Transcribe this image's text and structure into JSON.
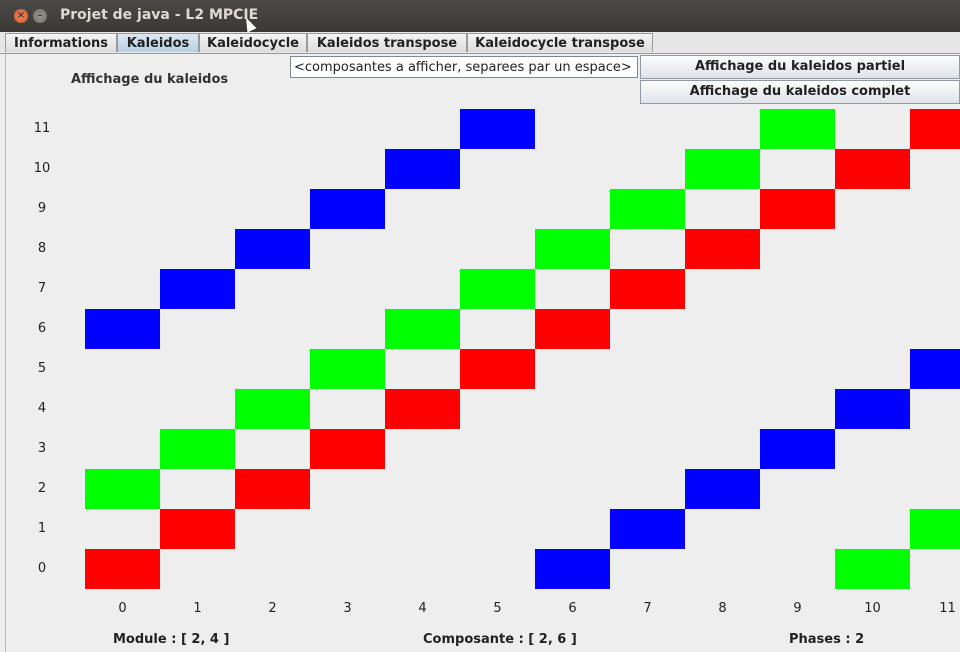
{
  "window": {
    "title": "Projet de java - L2 MPCIE"
  },
  "tabs": [
    "Informations",
    "Kaleidos",
    "Kaleidocycle",
    "Kaleidos transpose",
    "Kaleidocycle transpose"
  ],
  "heading": "Affichage du kaleidos",
  "components_input": {
    "value": "<composantes a afficher, separees par un espace>"
  },
  "buttons": {
    "partial": "Affichage du kaleidos partiel",
    "complete": "Affichage du kaleidos complet"
  },
  "grid": {
    "rows": [
      "0",
      "1",
      "2",
      "3",
      "4",
      "5",
      "6",
      "7",
      "8",
      "9",
      "10",
      "11"
    ],
    "cols": [
      "0",
      "1",
      "2",
      "3",
      "4",
      "5",
      "6",
      "7",
      "8",
      "9",
      "10",
      "11"
    ],
    "colors": {
      "red": "#ff0000",
      "green": "#00ff00",
      "blue": "#0000ff"
    },
    "cells": [
      {
        "c": 0,
        "r": 0,
        "color": "red"
      },
      {
        "c": 1,
        "r": 1,
        "color": "red"
      },
      {
        "c": 2,
        "r": 2,
        "color": "red"
      },
      {
        "c": 3,
        "r": 3,
        "color": "red"
      },
      {
        "c": 4,
        "r": 4,
        "color": "red"
      },
      {
        "c": 5,
        "r": 5,
        "color": "red"
      },
      {
        "c": 6,
        "r": 6,
        "color": "red"
      },
      {
        "c": 7,
        "r": 7,
        "color": "red"
      },
      {
        "c": 8,
        "r": 8,
        "color": "red"
      },
      {
        "c": 9,
        "r": 9,
        "color": "red"
      },
      {
        "c": 10,
        "r": 10,
        "color": "red"
      },
      {
        "c": 11,
        "r": 11,
        "color": "red"
      },
      {
        "c": 0,
        "r": 2,
        "color": "green"
      },
      {
        "c": 1,
        "r": 3,
        "color": "green"
      },
      {
        "c": 2,
        "r": 4,
        "color": "green"
      },
      {
        "c": 3,
        "r": 5,
        "color": "green"
      },
      {
        "c": 4,
        "r": 6,
        "color": "green"
      },
      {
        "c": 5,
        "r": 7,
        "color": "green"
      },
      {
        "c": 6,
        "r": 8,
        "color": "green"
      },
      {
        "c": 7,
        "r": 9,
        "color": "green"
      },
      {
        "c": 8,
        "r": 10,
        "color": "green"
      },
      {
        "c": 9,
        "r": 11,
        "color": "green"
      },
      {
        "c": 10,
        "r": 0,
        "color": "green"
      },
      {
        "c": 11,
        "r": 1,
        "color": "green"
      },
      {
        "c": 0,
        "r": 6,
        "color": "blue"
      },
      {
        "c": 1,
        "r": 7,
        "color": "blue"
      },
      {
        "c": 2,
        "r": 8,
        "color": "blue"
      },
      {
        "c": 3,
        "r": 9,
        "color": "blue"
      },
      {
        "c": 4,
        "r": 10,
        "color": "blue"
      },
      {
        "c": 5,
        "r": 11,
        "color": "blue"
      },
      {
        "c": 6,
        "r": 0,
        "color": "blue"
      },
      {
        "c": 7,
        "r": 1,
        "color": "blue"
      },
      {
        "c": 8,
        "r": 2,
        "color": "blue"
      },
      {
        "c": 9,
        "r": 3,
        "color": "blue"
      },
      {
        "c": 10,
        "r": 4,
        "color": "blue"
      },
      {
        "c": 11,
        "r": 5,
        "color": "blue"
      }
    ]
  },
  "footer": {
    "module": "Module : [ 2, 4 ]",
    "composante": "Composante : [ 2, 6 ]",
    "phases": "Phases : 2"
  }
}
